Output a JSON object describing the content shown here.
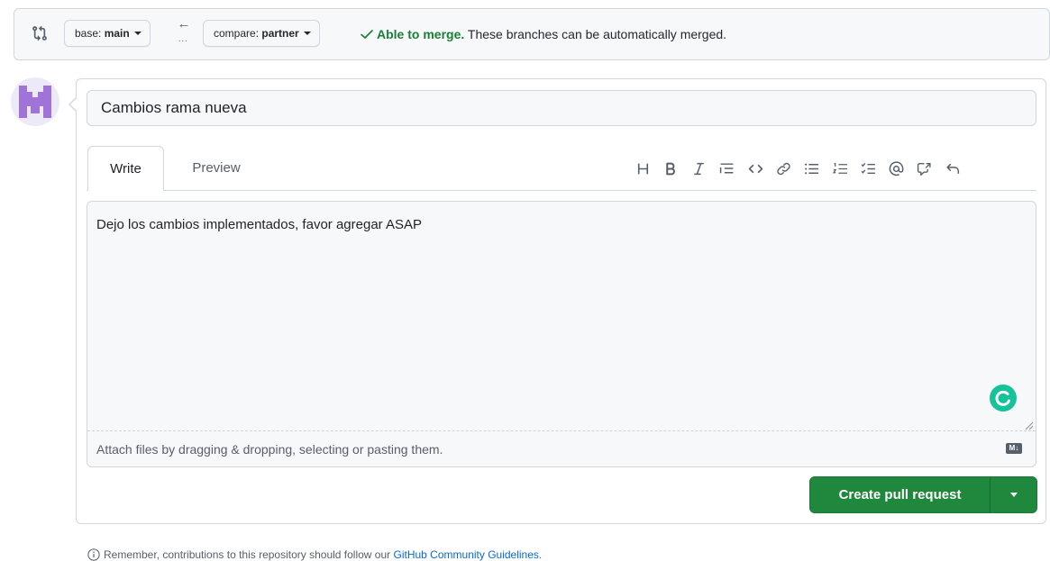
{
  "compare_bar": {
    "base_prefix": "base:",
    "base_branch": "main",
    "compare_prefix": "compare:",
    "compare_branch": "partner",
    "swap_arrow": "←",
    "swap_dots": "...",
    "merge_ok": "Able to merge.",
    "merge_msg": "These branches can be automatically merged."
  },
  "form": {
    "title_value": "Cambios rama nueva",
    "tabs": [
      {
        "label": "Write",
        "active": true
      },
      {
        "label": "Preview",
        "active": false
      }
    ],
    "toolbar_icons": [
      "heading-icon",
      "bold-icon",
      "italic-icon",
      "quote-icon",
      "code-icon",
      "link-icon",
      "unordered-list-icon",
      "ordered-list-icon",
      "task-list-icon",
      "mention-icon",
      "cross-reference-icon",
      "reply-icon"
    ],
    "body_text": "Dejo los cambios implementados, favor agregar ASAP",
    "attach_hint": "Attach files by dragging & dropping, selecting or pasting them.",
    "markdown_badge": "M↓",
    "submit_label": "Create pull request"
  },
  "footer": {
    "note_prefix": "Remember, contributions to this repository should follow our ",
    "link_text": "GitHub Community Guidelines",
    "note_suffix": "."
  },
  "colors": {
    "success": "#1a7f37",
    "primary_button": "#1f883d",
    "link": "#0969da",
    "grammarly": "#15c39a",
    "avatar": "#a173d8"
  }
}
